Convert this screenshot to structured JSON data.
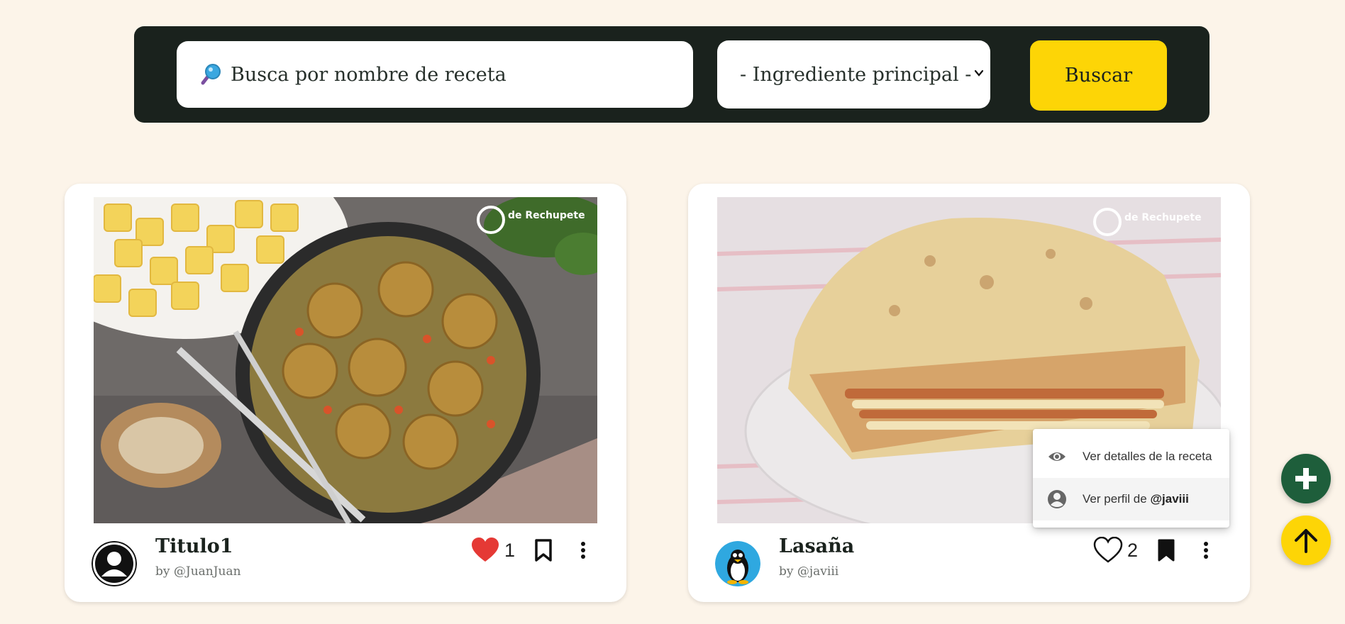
{
  "search": {
    "placeholder": "Busca por nombre de receta",
    "ingredient_select": "- Ingrediente principal -",
    "button_label": "Buscar"
  },
  "recipes": [
    {
      "title": "Titulo1",
      "author": "by @JuanJuan",
      "likes": "1",
      "liked": true,
      "saved": false,
      "photo_watermark": "de Rechupete"
    },
    {
      "title": "Lasaña",
      "author": "by @javiii",
      "likes": "2",
      "liked": false,
      "saved": true,
      "photo_watermark": "de Rechupete"
    }
  ],
  "context_menu": {
    "items": [
      {
        "icon": "eye-icon",
        "label": "Ver detalles de la receta"
      },
      {
        "icon": "account-circle-icon",
        "label_prefix": "Ver perfil de ",
        "label_user": "@javiii"
      }
    ]
  },
  "fabs": {
    "add_icon": "plus-icon",
    "top_icon": "arrow-up-icon"
  },
  "colors": {
    "page_bg": "#fcf4e9",
    "searchbar_bg": "#1a221d",
    "accent_yellow": "#fdd506",
    "fab_green": "#1e5e3b",
    "heart_red": "#e53935"
  }
}
